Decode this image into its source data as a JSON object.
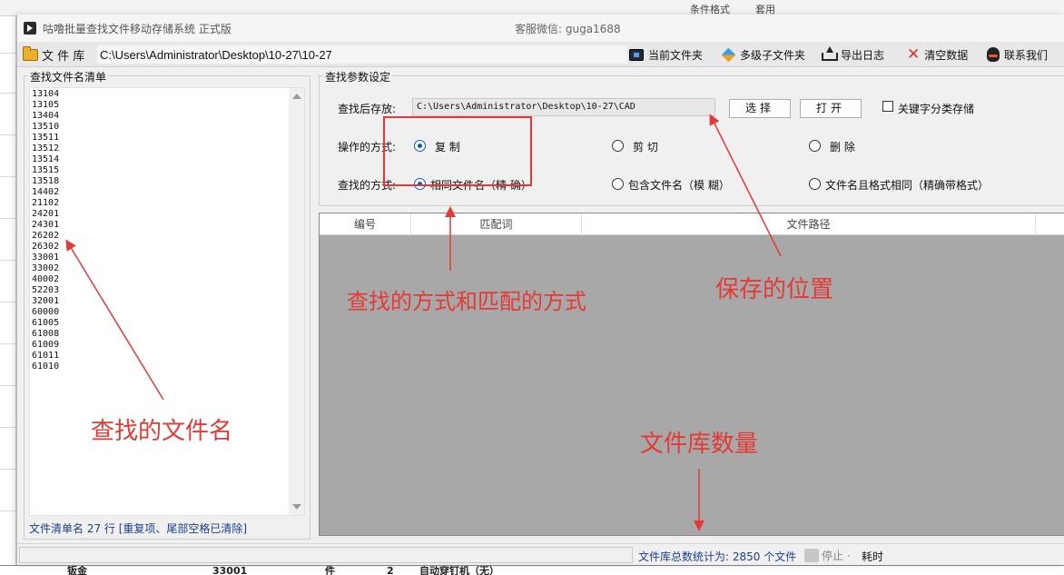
{
  "window": {
    "title": "咕噜批量查找文件移动存储系统   正式版",
    "wechat": "客服微信: guga1688"
  },
  "toolbar": {
    "library_label": "文 件 库",
    "library_path": "C:\\Users\\Administrator\\Desktop\\10-27\\10-27",
    "current_folder": "当前文件夹",
    "multi_subfolder": "多级子文件夹",
    "export_log": "导出日志",
    "clear_data": "清空数据",
    "contact_us": "联系我们"
  },
  "left_panel": {
    "group_title": "查找文件名清单",
    "items": [
      "13104",
      "13105",
      "13404",
      "13510",
      "13511",
      "13512",
      "13514",
      "13515",
      "13518",
      "14402",
      "21102",
      "24201",
      "24301",
      "26202",
      "26302",
      "33001",
      "33002",
      "40002",
      "52203",
      "32001",
      "60000",
      "61005",
      "61008",
      "61009",
      "61011",
      "61010"
    ],
    "status": "文件清单名 27 行  [重复项、尾部空格已清除]"
  },
  "params": {
    "group_title": "查找参数设定",
    "save_label": "查找后存放:",
    "save_path": "C:\\Users\\Administrator\\Desktop\\10-27\\CAD",
    "select_btn": "选择",
    "open_btn": "打开",
    "keyword_checkbox": "关键字分类存储",
    "operation_label": "操作的方式:",
    "operation_options": [
      "复 制",
      "剪 切",
      "删 除"
    ],
    "operation_selected": "复 制",
    "search_label": "查找的方式:",
    "search_options": [
      "相同文件名（精 确）",
      "包含文件名（模 糊）",
      "文件名且格式相同（精确带格式）"
    ],
    "search_selected": "相同文件名（精 确）"
  },
  "grid": {
    "columns": [
      "编号",
      "匹配词",
      "文件路径"
    ]
  },
  "statusbar": {
    "count_text": "文件库总数统计为: 2850 个文件",
    "stop_label": "停止 ·",
    "elapsed_label": "耗时"
  },
  "annotations": {
    "filename_label": "查找的文件名",
    "method_label": "查找的方式和匹配的方式",
    "save_location_label": "保存的位置",
    "library_count_label": "文件库数量",
    "color": "#e53935"
  },
  "background": {
    "ribbon_texts": [
      "条件格式",
      "套用"
    ],
    "bottom_texts": [
      "钣金",
      "33001",
      "件",
      "2",
      "自动穿钉机（无）"
    ]
  }
}
